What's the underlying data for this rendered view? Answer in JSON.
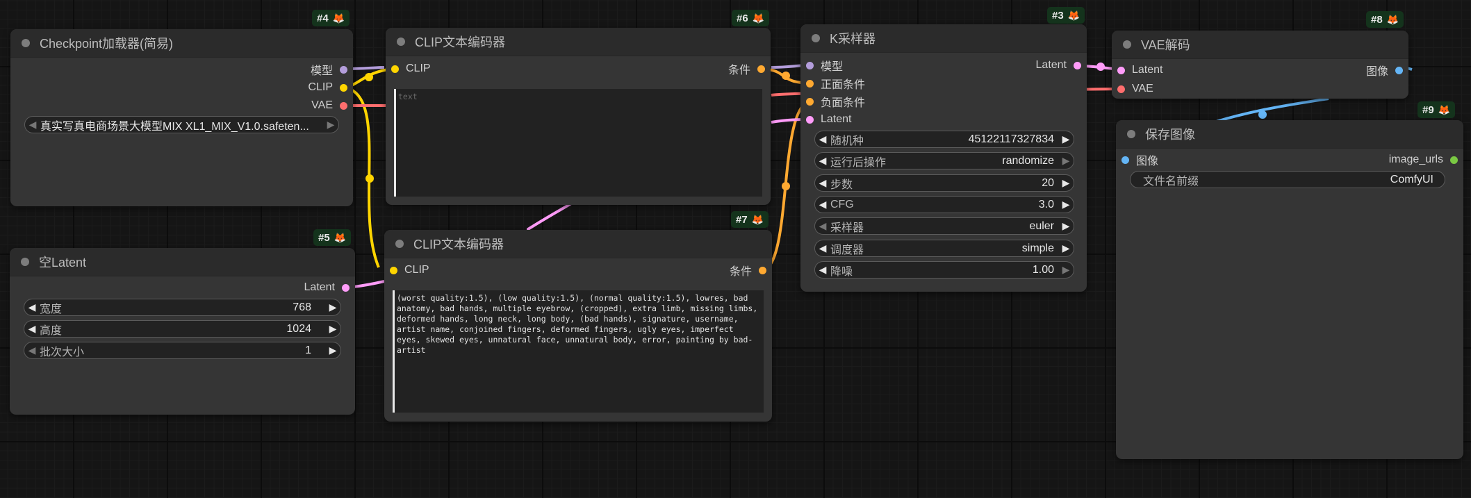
{
  "colors": {
    "model": "#b39ddb",
    "clip": "#ffd500",
    "vae": "#ff6e6e",
    "conditioning": "#ffa931",
    "latent": "#ff9cf9",
    "image": "#64b5f6",
    "string_out": "#7ac943"
  },
  "nodes": {
    "checkpoint": {
      "id": "#4",
      "title": "Checkpoint加载器(简易)",
      "outputs": [
        "模型",
        "CLIP",
        "VAE"
      ],
      "ckpt_name": "真实写真电商场景大模型MIX XL1_MIX_V1.0.safeten..."
    },
    "clip_pos": {
      "id": "#6",
      "title": "CLIP文本编码器",
      "input": "CLIP",
      "output": "条件",
      "placeholder": "text",
      "text": ""
    },
    "clip_neg": {
      "id": "#7",
      "title": "CLIP文本编码器",
      "input": "CLIP",
      "output": "条件",
      "text": "(worst quality:1.5), (low quality:1.5), (normal quality:1.5), lowres, bad anatomy, bad hands, multiple eyebrow, (cropped), extra limb, missing limbs, deformed hands, long neck, long body, (bad hands), signature, username, artist name, conjoined fingers, deformed fingers, ugly eyes, imperfect eyes, skewed eyes, unnatural face, unnatural body, error, painting by bad-artist"
    },
    "empty_latent": {
      "id": "#5",
      "title": "空Latent",
      "output": "Latent",
      "width_label": "宽度",
      "width": "768",
      "height_label": "高度",
      "height": "1024",
      "batch_label": "批次大小",
      "batch": "1"
    },
    "ksampler": {
      "id": "#3",
      "title": "K采样器",
      "inputs": [
        "模型",
        "正面条件",
        "负面条件",
        "Latent"
      ],
      "output": "Latent",
      "widgets": [
        {
          "label": "随机种",
          "value": "45122117327834"
        },
        {
          "label": "运行后操作",
          "value": "randomize"
        },
        {
          "label": "步数",
          "value": "20"
        },
        {
          "label": "CFG",
          "value": "3.0"
        },
        {
          "label": "采样器",
          "value": "euler"
        },
        {
          "label": "调度器",
          "value": "simple"
        },
        {
          "label": "降噪",
          "value": "1.00"
        }
      ]
    },
    "vae_decode": {
      "id": "#8",
      "title": "VAE解码",
      "inputs": [
        "Latent",
        "VAE"
      ],
      "output": "图像"
    },
    "save_image": {
      "id": "#9",
      "title": "保存图像",
      "input": "图像",
      "output": "image_urls",
      "prefix_label": "文件名前缀",
      "prefix": "ComfyUI"
    }
  }
}
